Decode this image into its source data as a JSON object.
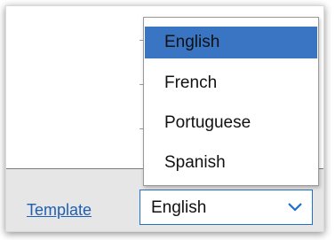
{
  "footer": {
    "template_link": "Template"
  },
  "language_select": {
    "selected": "English",
    "options": [
      "English",
      "French",
      "Portuguese",
      "Spanish"
    ],
    "highlighted": "English"
  },
  "colors": {
    "highlight": "#3a75c4",
    "link": "#1f5fb3",
    "select_border": "#1f6fd0",
    "footer_bg": "#e6e6e6"
  }
}
